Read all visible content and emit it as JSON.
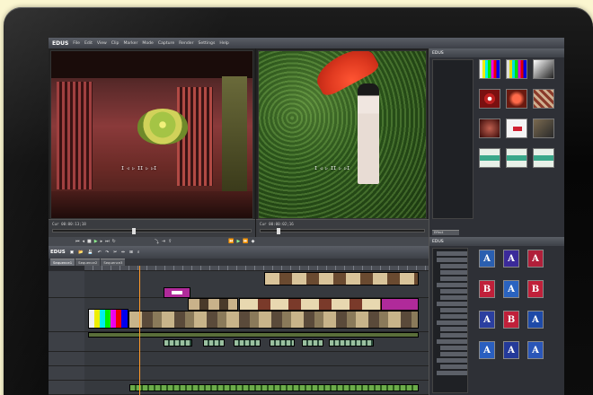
{
  "app": {
    "name": "EDUS",
    "menus": [
      "File",
      "Edit",
      "View",
      "Clip",
      "Marker",
      "Mode",
      "Capture",
      "Render",
      "Settings",
      "Help"
    ]
  },
  "player": {
    "timecode": "Cur 00:00:13;18"
  },
  "recorder": {
    "timecode": "Cur 00:00:02;16"
  },
  "overlay_controls": {
    "player": "I ◁ ▷ II ▷ ▷I",
    "recorder": "I ◁ ▷ II ▷ ▷I"
  },
  "effect_panel": {
    "title": "EDUS",
    "tab": "Effect"
  },
  "timeline": {
    "title": "EDUS",
    "tabs": [
      "Sequence1",
      "Sequence2",
      "Sequence3"
    ]
  },
  "bin": {
    "title": "EDUS"
  },
  "effect_thumb_labels": [
    "",
    "",
    "",
    "",
    "",
    "",
    "",
    "",
    "",
    "",
    "",
    ""
  ],
  "effect_letters": [
    "A",
    "A",
    "A",
    "B",
    "A",
    "B",
    "A",
    "B",
    "A",
    "A",
    "A",
    "A"
  ],
  "effect_letter_colors": [
    "#2a5fb0",
    "#3b2a9a",
    "#b01f3a",
    "#c0203a",
    "#2a63c0",
    "#c0203a",
    "#2b3fa0",
    "#c0203a",
    "#1e4aa8",
    "#2a5fc0",
    "#243a9a",
    "#2a56b8"
  ],
  "colors": {
    "accent": "#ff9a2a",
    "title_clip": "#b02a9a"
  }
}
